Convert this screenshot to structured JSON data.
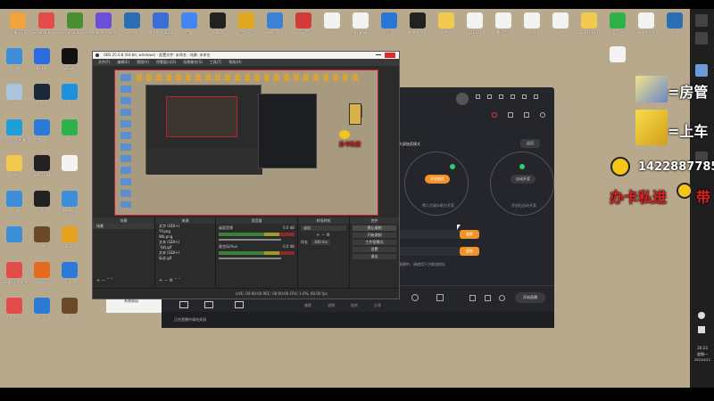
{
  "desktop_icons": [
    {
      "label": "万能 GFT",
      "color": "#f2a33a"
    },
    {
      "label": "GeForce Experience",
      "color": "#e34b4b"
    },
    {
      "label": "GeForce Experience",
      "color": "#4a8f2f"
    },
    {
      "label": "Adobe Premiere Pro",
      "color": "#6b4fd8"
    },
    {
      "label": "Steam",
      "color": "#2a6fb3"
    },
    {
      "label": "腾讯视频 2021",
      "color": "#3b6ed8"
    },
    {
      "label": "百度",
      "color": "#4285f4"
    },
    {
      "label": "Adobe",
      "color": "#222222"
    },
    {
      "label": "百度网盘",
      "color": "#e0a81c"
    },
    {
      "label": "WeGame",
      "color": "#3a82d6"
    },
    {
      "label": "网易云音乐",
      "color": "#d33a3a"
    },
    {
      "label": "文档",
      "color": "#f3f3f3"
    },
    {
      "label": "fanyibaiqin",
      "color": "#f3f3f3"
    },
    {
      "label": "向日葵",
      "color": "#2a75d8"
    },
    {
      "label": "剪映专业版",
      "color": "#222222"
    },
    {
      "label": "文件夹",
      "color": "#f3c94f"
    },
    {
      "label": "121212",
      "color": "#f3f3f3"
    },
    {
      "label": "腾讯会议",
      "color": "#f3f3f3"
    },
    {
      "label": "Zoom",
      "color": "#f3f3f3"
    },
    {
      "label": "文件",
      "color": "#f3f3f3"
    },
    {
      "label": "20210417",
      "color": "#f3c94f"
    },
    {
      "label": "爱奇艺",
      "color": "#2db24a"
    },
    {
      "label": "新建文件夹",
      "color": "#f3f3f3"
    },
    {
      "label": "浏览器",
      "color": "#2a6fb3"
    }
  ],
  "left_icons": [
    {
      "label": "此电脑",
      "color": "#3b8fd8"
    },
    {
      "label": "KaiHei",
      "color": "#2b6cde"
    },
    {
      "label": "VEGAS",
      "color": "#111111"
    },
    {
      "label": "回收站",
      "color": "#aac4de"
    },
    {
      "label": "Steam",
      "color": "#1b2838"
    },
    {
      "label": "QQ",
      "color": "#1f8fe0"
    },
    {
      "label": "Microsoft Edge",
      "color": "#1f9fd8"
    },
    {
      "label": "控制面板",
      "color": "#2d7bd8"
    },
    {
      "label": "微信",
      "color": "#2db24a"
    },
    {
      "label": "文件",
      "color": "#f3c94f"
    },
    {
      "label": "WARZONE",
      "color": "#222222"
    },
    {
      "label": "文档",
      "color": "#f3f3f3"
    },
    {
      "label": "此电脑",
      "color": "#3b8fd8"
    },
    {
      "label": "QQ",
      "color": "#222222"
    },
    {
      "label": "Network",
      "color": "#3b8fd8"
    },
    {
      "label": "YY",
      "color": "#3b8fd8"
    },
    {
      "label": "人物",
      "color": "#6b4a2a"
    },
    {
      "label": "ESO",
      "color": "#e5a21f"
    },
    {
      "label": "Google Chrome",
      "color": "#e34b4b"
    },
    {
      "label": "网易云",
      "color": "#e36b1f"
    },
    {
      "label": "Windows",
      "color": "#2d7bd8"
    },
    {
      "label": "Chrome",
      "color": "#e34b4b"
    },
    {
      "label": "任务",
      "color": "#2d7bd8"
    },
    {
      "label": "图片",
      "color": "#6b4a2a"
    }
  ],
  "obs": {
    "title": "OBS 25.0.8 (64-bit, windows) - 配置文件: 未命名 - 场景: 未命名",
    "menu": [
      "文件(F)",
      "编辑(E)",
      "视图(V)",
      "停靠窗口(D)",
      "场景集合(S)",
      "工具(T)",
      "帮助(H)"
    ],
    "docks": {
      "scenes": "场景",
      "sources": "来源",
      "mixer": "混音器",
      "transitions": "转场特效",
      "controls": "控件"
    },
    "scene_items": [
      "场景"
    ],
    "source_items": [
      "文字 (GDI+)",
      "YY.png",
      "Wb.png",
      "文本 (GDI+)",
      "飞机.gif",
      "文本 (GDI+)",
      "标志.gif"
    ],
    "mixer": [
      {
        "name": "桌面音频",
        "db": "0.0 dB"
      },
      {
        "name": "麦克风/Aux",
        "db": "0.0 dB"
      }
    ],
    "transition": "淡出",
    "duration_label": "时长",
    "duration": "300 ms",
    "controls": [
      "停止录制",
      "开始录制",
      "工作室模式",
      "设置",
      "退出"
    ],
    "status": "LIVE: 00:00:00   REC: 00:00:00   CPU: 1.0%, 60.00 fps"
  },
  "dark_app": {
    "mode_label": "大屏抽奖模式",
    "back_button": "返回",
    "left_btn": "开启抽奖",
    "right_btn": "自动开奖",
    "left_text": "将二方观众助力开奖",
    "right_text": "开启后自动开奖",
    "key1_button": "复制",
    "key2_button": "复制",
    "hint": "直播中，请使用下方推流地址",
    "bottom_btn": "开始直播",
    "footer_text": "正在直播中请勿关闭",
    "bottom_labels": [
      "美颜",
      "滤镜",
      "贴纸",
      "分享"
    ]
  },
  "overlay": {
    "line1": "=房管",
    "line2": "=上车",
    "qq_number": "1422887785",
    "banner": "办卡私进",
    "banner_end": "带",
    "small_banner": "办卡私进"
  },
  "small_window": {
    "label": "系统原因"
  },
  "tray": {
    "time": "20:23",
    "day": "星期一",
    "date": "2022/4/11"
  },
  "colors": {
    "desktop": "#b8a98d",
    "accent": "#f0932b",
    "obs_border": "#c02030",
    "banner_red": "#e01f1f"
  }
}
